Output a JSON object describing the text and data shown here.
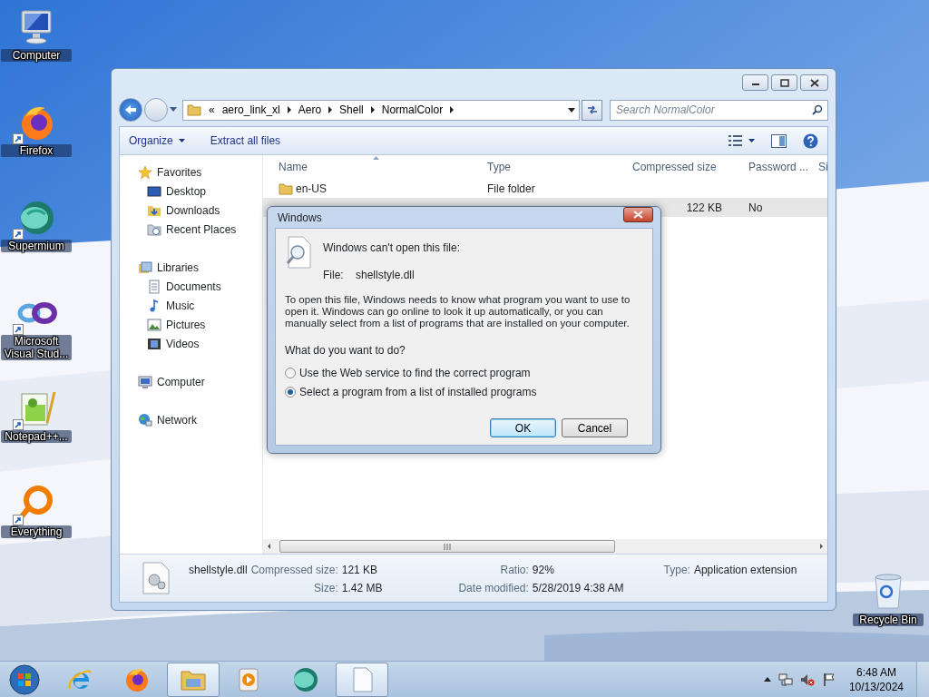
{
  "desktop_icons": [
    {
      "kind": "computer",
      "label": "Computer",
      "shortcut": false
    },
    {
      "kind": "firefox",
      "label": "Firefox",
      "shortcut": true
    },
    {
      "kind": "supermium",
      "label": "Supermium",
      "shortcut": true
    },
    {
      "kind": "visualstudio",
      "label": "Microsoft Visual Stud...",
      "shortcut": true
    },
    {
      "kind": "notepad",
      "label": "Notepad++...",
      "shortcut": true
    },
    {
      "kind": "everything",
      "label": "Everything",
      "shortcut": true
    },
    {
      "kind": "recyclebin",
      "label": "Recycle Bin",
      "shortcut": false
    }
  ],
  "explorer": {
    "breadcrumb": {
      "overflow": "«",
      "segments": [
        "aero_link_xl",
        "Aero",
        "Shell",
        "NormalColor"
      ]
    },
    "search": {
      "placeholder": "Search NormalColor"
    },
    "commands": [
      {
        "label": "Organize",
        "dropdown": true
      },
      {
        "label": "Extract all files",
        "dropdown": false
      }
    ],
    "nav": [
      {
        "kind": "star",
        "label": "Favorites",
        "children": [
          {
            "kind": "desktop",
            "label": "Desktop"
          },
          {
            "kind": "downloads",
            "label": "Downloads"
          },
          {
            "kind": "recent",
            "label": "Recent Places"
          }
        ]
      },
      {
        "kind": "libraries",
        "label": "Libraries",
        "children": [
          {
            "kind": "documents",
            "label": "Documents"
          },
          {
            "kind": "music",
            "label": "Music"
          },
          {
            "kind": "pictures",
            "label": "Pictures"
          },
          {
            "kind": "videos",
            "label": "Videos"
          }
        ]
      },
      {
        "kind": "computer",
        "label": "Computer"
      },
      {
        "kind": "network",
        "label": "Network"
      }
    ],
    "columns": [
      "Name",
      "Type",
      "Compressed size",
      "Password ...",
      "Si"
    ],
    "rows": [
      {
        "kind": "folder",
        "name": "en-US",
        "type": "File folder",
        "selected": false
      },
      {
        "compressed_size": "122 KB",
        "password": "No",
        "selected": true
      }
    ],
    "details": {
      "file_name": "shellstyle.dll",
      "fields": [
        {
          "label": "Compressed size:",
          "value": "121 KB"
        },
        {
          "label": "Size:",
          "value": "1.42 MB"
        },
        {
          "label": "Ratio:",
          "value": "92%"
        },
        {
          "label": "Date modified:",
          "value": "5/28/2019 4:38 AM"
        },
        {
          "label": "Type:",
          "value": "Application extension"
        }
      ]
    }
  },
  "dialog": {
    "title": "Windows",
    "heading": "Windows can't open this file:",
    "file_label": "File:",
    "file_name": "shellstyle.dll",
    "message": "To open this file, Windows needs to know what program you want to use to open it. Windows can go online to look it up automatically, or you can manually select from a list of programs that are installed on your computer.",
    "question": "What do you want to do?",
    "options": [
      {
        "label": "Use the Web service to find the correct program",
        "selected": false
      },
      {
        "label": "Select a program from a list of installed programs",
        "selected": true
      }
    ],
    "buttons": [
      {
        "label": "OK",
        "default": true
      },
      {
        "label": "Cancel",
        "default": false
      }
    ]
  },
  "taskbar": {
    "apps": [
      {
        "kind": "ie",
        "active": false
      },
      {
        "kind": "firefox",
        "active": false
      },
      {
        "kind": "explorer",
        "active": true
      },
      {
        "kind": "media",
        "active": false
      },
      {
        "kind": "supermium",
        "active": false
      },
      {
        "kind": "document",
        "active": true
      }
    ],
    "clock": {
      "time": "6:48 AM",
      "date": "10/13/2024"
    }
  }
}
